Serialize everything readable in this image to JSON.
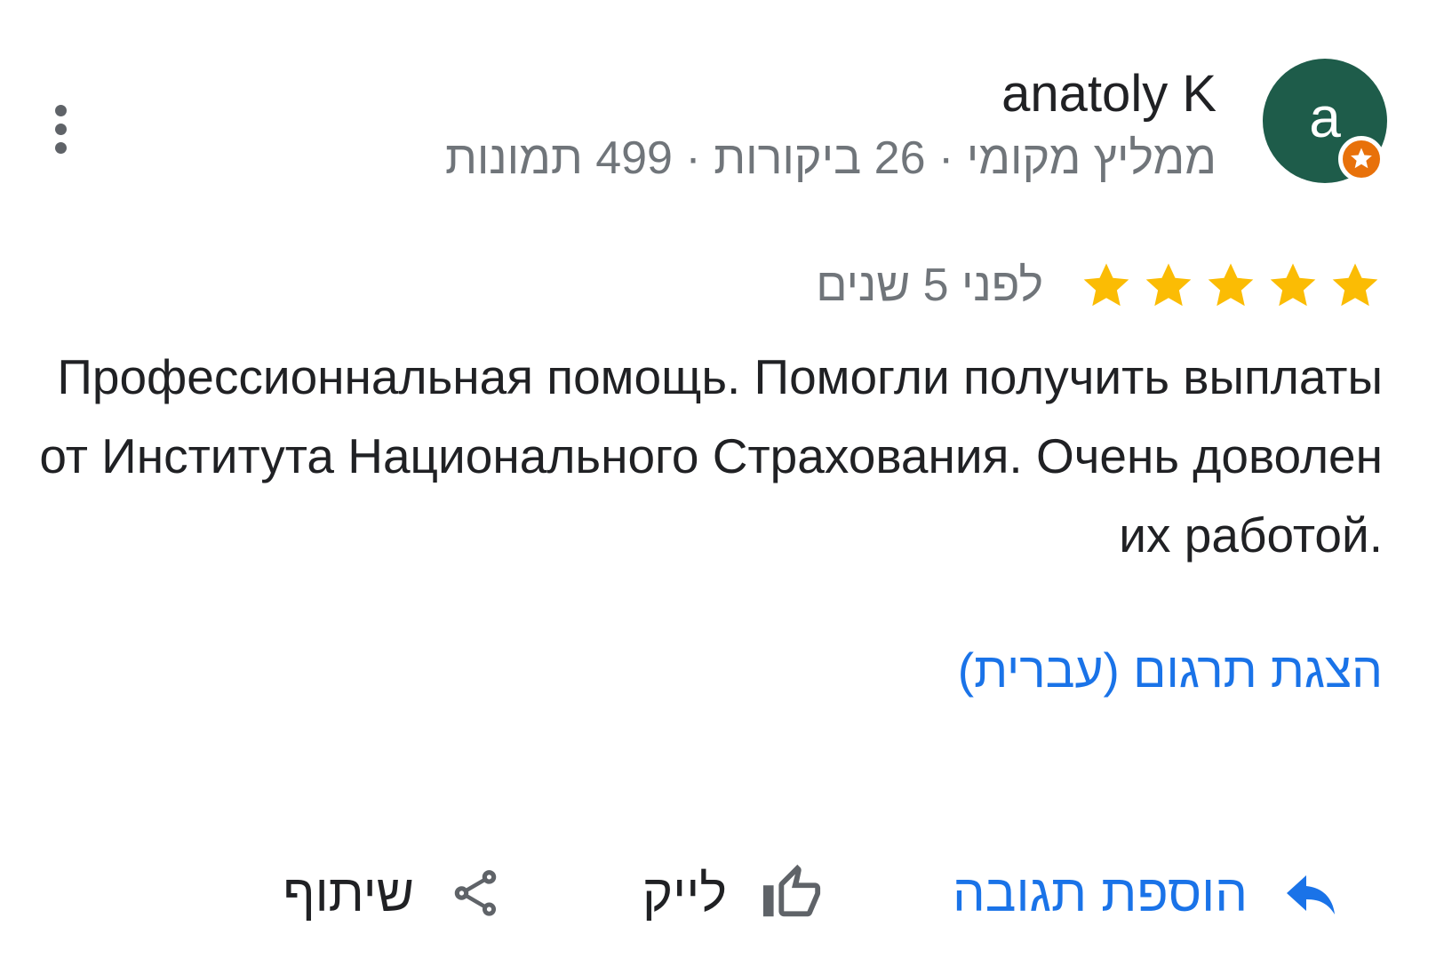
{
  "author": {
    "name": "anatoly K",
    "avatar_letter": "a",
    "avatar_color": "#1e5c4a",
    "badge_color": "#e8710a",
    "meta": "ממליץ מקומי · 26 ביקורות · 499 תמונות"
  },
  "review": {
    "rating": 5,
    "star_color": "#fbbc04",
    "time_ago": "לפני 5 שנים",
    "text": "Профессионнальная помощь. Помогли получить выплаты от Института Национального Страхования. Очень доволен их работой.",
    "translate_link": "הצגת תרגום (עברית)"
  },
  "actions": {
    "reply_label": "הוספת תגובה",
    "like_label": "לייק",
    "share_label": "שיתוף"
  },
  "colors": {
    "link_blue": "#1a73e8",
    "text_primary": "#202124",
    "text_secondary": "#70757a",
    "icon_gray": "#5f6368"
  }
}
